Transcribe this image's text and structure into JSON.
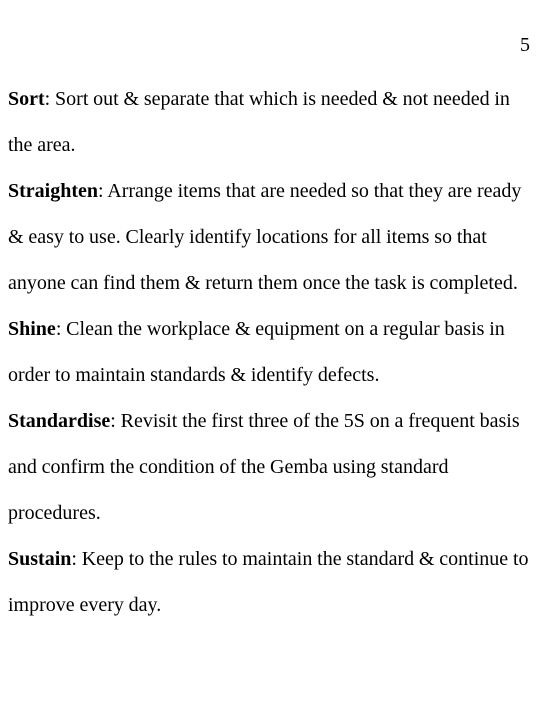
{
  "document": {
    "page_number": "5",
    "paragraphs": [
      {
        "term": "Sort",
        "separator": ": ",
        "text": "Sort out & separate that which is needed & not needed in the area."
      },
      {
        "term": "Straighten",
        "separator": ": ",
        "text": "Arrange items that are needed so that they are ready & easy to use. Clearly identify locations for all items so that anyone can find them & return them once the task is completed."
      },
      {
        "term": "Shine",
        "separator": ": ",
        "text": "Clean the workplace & equipment on a regular basis in order to maintain standards & identify defects."
      },
      {
        "term": "Standardise",
        "separator": ": ",
        "text": "Revisit the first three of the 5S on a frequent basis and confirm the condition of the Gemba using standard procedures."
      },
      {
        "term": "Sustain",
        "separator": ": ",
        "text": "Keep to the rules to maintain the standard & continue to improve every day."
      }
    ]
  }
}
